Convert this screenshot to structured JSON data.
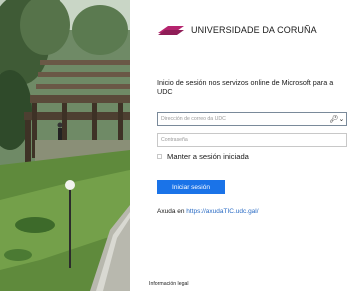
{
  "brand": {
    "name": "UNIVERSIDADE DA CORUÑA"
  },
  "login": {
    "heading": "Inicio de sesión nos servizos online de Microsoft para a UDC",
    "email_placeholder": "Dirección de correo da UDC",
    "password_placeholder": "Contraseña",
    "remember_label": "Manter a sesión iniciada",
    "submit_label": "Iniciar sesión"
  },
  "help": {
    "prefix": "Axuda en ",
    "link_text": "https://axudaTIC.udc.gal/"
  },
  "footer": {
    "legal": "Información legal"
  },
  "colors": {
    "background": "#0f8a93",
    "accent": "#1a73e8",
    "link": "#2a6bc4",
    "logo": "#b5246e"
  },
  "icons": {
    "password_manager": "key-icon",
    "brand": "udc-logo-icon"
  }
}
